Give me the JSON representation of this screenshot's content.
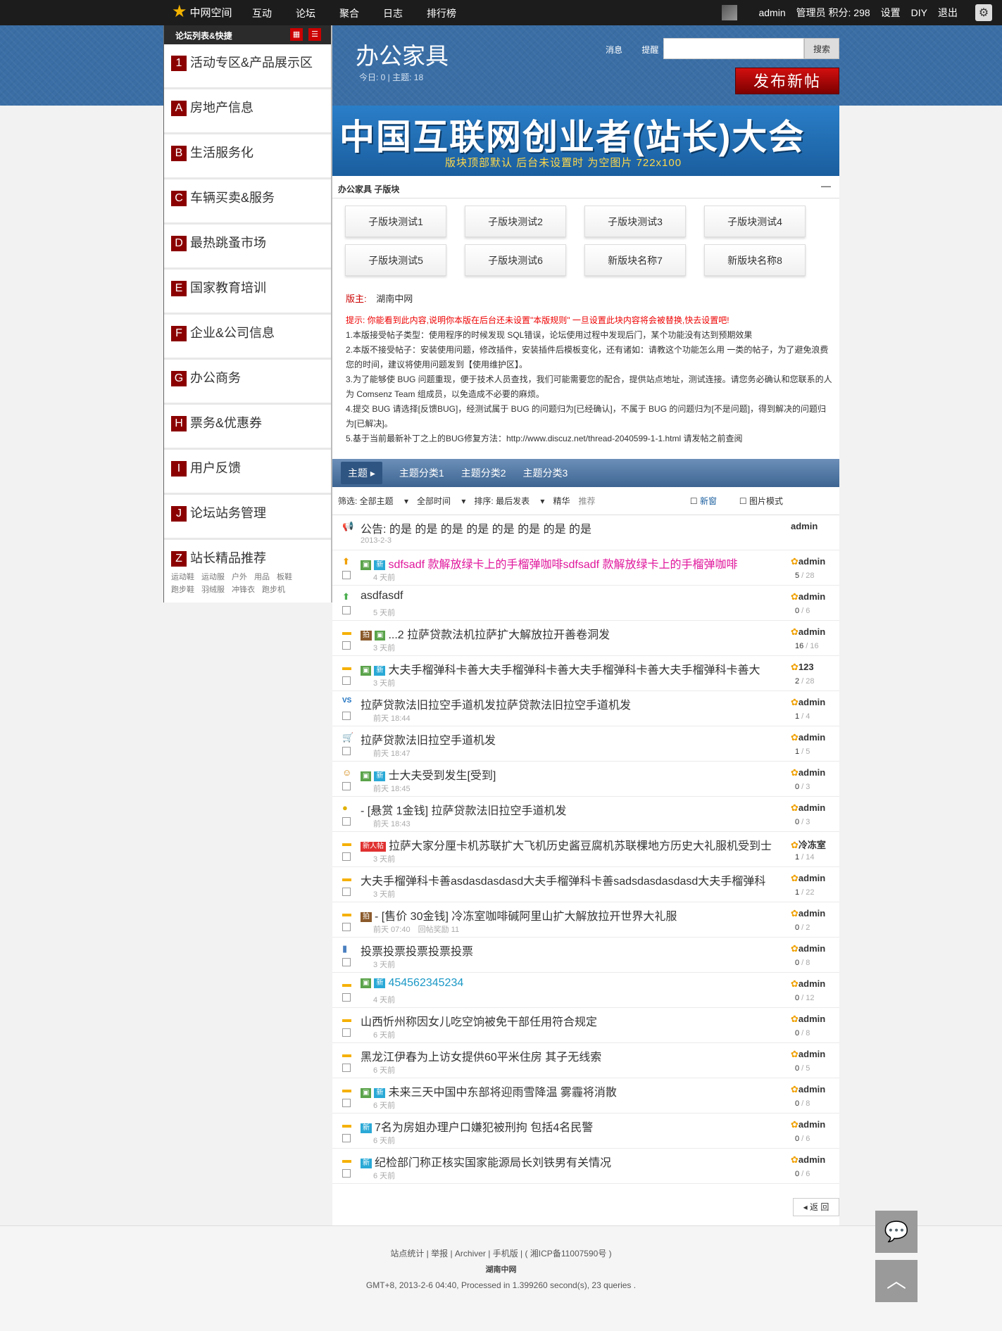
{
  "topbar": {
    "logo_text": "中网空间",
    "nav": [
      "互动",
      "论坛",
      "聚合",
      "日志",
      "排行榜"
    ],
    "username": "admin",
    "role_points": "管理员 积分: 298",
    "settings": "设置",
    "diy": "DIY",
    "logout": "退出"
  },
  "sidebar": {
    "title": "论坛列表&快捷",
    "categories": [
      {
        "letter": "1",
        "label": "活动专区&产品展示区"
      },
      {
        "letter": "A",
        "label": "房地产信息"
      },
      {
        "letter": "B",
        "label": "生活服务化"
      },
      {
        "letter": "C",
        "label": "车辆买卖&服务"
      },
      {
        "letter": "D",
        "label": "最热跳蚤市场"
      },
      {
        "letter": "E",
        "label": "国家教育培训"
      },
      {
        "letter": "F",
        "label": "企业&公司信息"
      },
      {
        "letter": "G",
        "label": "办公商务"
      },
      {
        "letter": "H",
        "label": "票务&优惠券"
      },
      {
        "letter": "I",
        "label": "用户反馈"
      },
      {
        "letter": "J",
        "label": "论坛站务管理"
      },
      {
        "letter": "Z",
        "label": "站长精品推荐"
      }
    ],
    "z_tags": [
      "运动鞋",
      "运动服",
      "户外",
      "用品",
      "板鞋",
      "跑步鞋",
      "羽绒服",
      "冲锋衣",
      "跑步机"
    ]
  },
  "header": {
    "forum_title": "办公家具",
    "stats": "今日: 0 | 主题: 18",
    "messages": "消息",
    "reminders": "提醒",
    "search_button": "搜索",
    "post_button": "发布新帖"
  },
  "banner": {
    "title": "中国互联网创业者(站长)大会",
    "subtitle": "版块顶部默认 后台未设置时 为空图片 722x100"
  },
  "subforums": {
    "title": "办公家具 子版块",
    "items": [
      "子版块测试1",
      "子版块测试2",
      "子版块测试3",
      "子版块测试4",
      "子版块测试5",
      "子版块测试6",
      "新版块名称7",
      "新版块名称8"
    ]
  },
  "moderator": {
    "label": "版主:",
    "name": "湖南中网"
  },
  "notice": {
    "intro": "提示: 你能看到此内容,说明你本版在后台还未设置\"本版规则\" 一旦设置此块内容将会被替换,快去设置吧!",
    "lines": [
      "1.本版接受帖子类型：使用程序的时候发现 SQL错误，论坛使用过程中发现后门，某个功能没有达到预期效果",
      "2.本版不接受帖子：安装使用问题，修改插件，安装插件后模板变化，还有诸如：请教这个功能怎么用 一类的帖子，为了避免浪费您的时间，建议将使用问题发到【使用维护区】。",
      "3.为了能够使 BUG 问题重现，便于技术人员查找，我们可能需要您的配合，提供站点地址，测试连接。请您务必确认和您联系的人为 Comsenz Team 组成员，以免造成不必要的麻烦。",
      "4.提交 BUG 请选择[反馈BUG]，经测试属于 BUG 的问题归为[已经确认]，不属于 BUG 的问题归为[不是问题]，得到解决的问题归为[已解决]。",
      "5.基于当前最新补丁之上的BUG修复方法：http://www.discuz.net/thread-2040599-1-1.html 请发帖之前查阅"
    ]
  },
  "typebar": {
    "tabs": [
      "主题",
      "主题分类1",
      "主题分类2",
      "主题分类3"
    ]
  },
  "filter": {
    "items": [
      "筛选: 全部主题",
      "全部时间",
      "排序: 最后发表",
      "精华",
      "推荐"
    ],
    "newwin": "新窗",
    "picmode": "图片模式"
  },
  "threads": [
    {
      "icon": "announce",
      "badges": [],
      "title": "公告: 的是 的是 的是 的是 的是 的是 的是 的是",
      "meta": "2013-2-3",
      "author": "admin",
      "count": "",
      "style": ""
    },
    {
      "icon": "up",
      "badges": [
        "img",
        "new"
      ],
      "title": "sdfsadf 款解放绿卡上的手榴弹咖啡sdfsadf 款解放绿卡上的手榴弹咖啡",
      "meta": "4 天前",
      "author": "admin",
      "count_a": "5",
      "count_b": "28",
      "style": "pink"
    },
    {
      "icon": "green-up",
      "badges": [],
      "title": "asdfasdf",
      "meta": "5 天前",
      "author": "admin",
      "count_a": "0",
      "count_b": "6",
      "style": ""
    },
    {
      "icon": "folder",
      "badges": [
        "pic",
        "img"
      ],
      "title": "...2 拉萨贷款法机拉萨扩大解放拉开善卷洞发",
      "meta": "3 天前",
      "author": "admin",
      "count_a": "16",
      "count_b": "16",
      "style": ""
    },
    {
      "icon": "folder",
      "badges": [
        "img",
        "new"
      ],
      "title": "大夫手榴弹科卡善大夫手榴弹科卡善大夫手榴弹科卡善大夫手榴弹科卡善大",
      "meta": "3 天前",
      "author": "123",
      "count_a": "2",
      "count_b": "28",
      "style": ""
    },
    {
      "icon": "vs",
      "badges": [],
      "title": "拉萨贷款法旧拉空手道机发拉萨贷款法旧拉空手道机发",
      "meta": "前天 18:44",
      "author": "admin",
      "count_a": "1",
      "count_b": "4",
      "style": ""
    },
    {
      "icon": "cart",
      "badges": [],
      "title": "拉萨贷款法旧拉空手道机发",
      "meta": "前天 18:47",
      "author": "admin",
      "count_a": "1",
      "count_b": "5",
      "style": ""
    },
    {
      "icon": "people",
      "badges": [
        "img",
        "new"
      ],
      "title": "士大夫受到发生[受到]",
      "meta": "前天 18:45",
      "author": "admin",
      "count_a": "0",
      "count_b": "3",
      "style": ""
    },
    {
      "icon": "coin",
      "badges": [],
      "title": "- [悬赏 1金钱] 拉萨贷款法旧拉空手道机发",
      "meta": "前天 18:43",
      "author": "admin",
      "count_a": "0",
      "count_b": "3",
      "style": ""
    },
    {
      "icon": "folder",
      "badges": [
        "newbie"
      ],
      "title": "拉萨大家分厘卡机苏联扩大飞机历史酱豆腐机苏联棵地方历史大礼服机受到士",
      "meta": "3 天前",
      "author": "冷冻室",
      "count_a": "1",
      "count_b": "14",
      "style": ""
    },
    {
      "icon": "folder",
      "badges": [],
      "title": "大夫手榴弹科卡善asdasdasdasd大夫手榴弹科卡善sadsdasdasdasd大夫手榴弹科",
      "meta": "3 天前",
      "author": "admin",
      "count_a": "1",
      "count_b": "22",
      "style": ""
    },
    {
      "icon": "folder",
      "badges": [
        "pic"
      ],
      "title": "- [售价 30金钱] 冷冻室咖啡碱阿里山扩大解放拉开世界大礼服",
      "meta": "前天 07:40　回帖奖励 11",
      "author": "admin",
      "count_a": "0",
      "count_b": "2",
      "style": ""
    },
    {
      "icon": "poll",
      "badges": [],
      "title": "投票投票投票投票投票",
      "meta": "3 天前",
      "author": "admin",
      "count_a": "0",
      "count_b": "8",
      "style": ""
    },
    {
      "icon": "folder",
      "badges": [
        "img",
        "new"
      ],
      "title": "454562345234",
      "meta": "4 天前",
      "author": "admin",
      "count_a": "0",
      "count_b": "12",
      "style": "teal"
    },
    {
      "icon": "folder",
      "badges": [],
      "title": "山西忻州称因女儿吃空饷被免干部任用符合规定",
      "meta": "6 天前",
      "author": "admin",
      "count_a": "0",
      "count_b": "8",
      "style": ""
    },
    {
      "icon": "folder",
      "badges": [],
      "title": "黑龙江伊春为上访女提供60平米住房 其子无线索",
      "meta": "6 天前",
      "author": "admin",
      "count_a": "0",
      "count_b": "5",
      "style": ""
    },
    {
      "icon": "folder",
      "badges": [
        "img",
        "new"
      ],
      "title": "未来三天中国中东部将迎雨雪降温 雾霾将消散",
      "meta": "6 天前",
      "author": "admin",
      "count_a": "0",
      "count_b": "8",
      "style": ""
    },
    {
      "icon": "folder",
      "badges": [
        "new"
      ],
      "title": "7名为房姐办理户口嫌犯被刑拘 包括4名民警",
      "meta": "6 天前",
      "author": "admin",
      "count_a": "0",
      "count_b": "6",
      "style": ""
    },
    {
      "icon": "folder",
      "badges": [
        "new"
      ],
      "title": "纪检部门称正核实国家能源局长刘铁男有关情况",
      "meta": "6 天前",
      "author": "admin",
      "count_a": "0",
      "count_b": "6",
      "style": ""
    }
  ],
  "back_button": "返 回",
  "footer": {
    "links": "站点统计 | 举报 | Archiver | 手机版 | ( 湘ICP备11007590号 )",
    "site_name": "湖南中网",
    "stats": "GMT+8, 2013-2-6 04:40, Processed in 1.399260 second(s), 23 queries ."
  },
  "colors": {
    "header_blue": "#3a6ea5",
    "accent_red": "#8b0000",
    "title_pink": "#e0179c",
    "title_teal": "#1a98c6"
  }
}
